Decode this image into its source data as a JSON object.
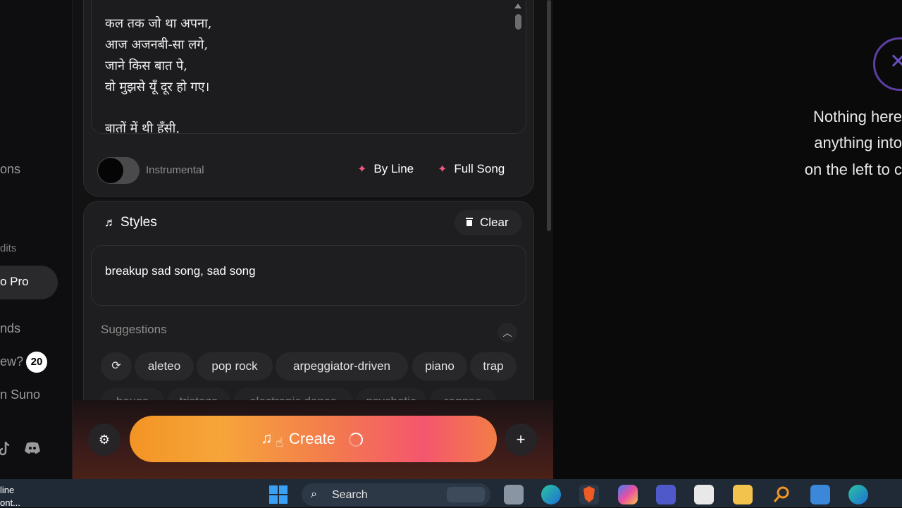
{
  "sidebar": {
    "items": [
      {
        "label": "ons"
      },
      {
        "label": "dits"
      },
      {
        "label": "o Pro"
      },
      {
        "label": "nds"
      },
      {
        "label": "ew?"
      },
      {
        "label": "n Suno"
      }
    ],
    "badge": "20",
    "social_icons": [
      "tiktok-icon",
      "discord-icon"
    ]
  },
  "lyrics": {
    "lines": [
      "कल तक जो था अपना,",
      "आज अजनबी-सा लगे,",
      "जाने किस बात पे,",
      "वो मुझसे यूँ दूर हो गए।",
      "बातों में थी हँसी,"
    ],
    "instrumental_label": "Instrumental",
    "by_line_label": "By Line",
    "full_song_label": "Full Song"
  },
  "styles": {
    "title": "Styles",
    "clear_label": "Clear",
    "value": "breakup sad song, sad song",
    "suggestions_label": "Suggestions",
    "chips": [
      "aleteo",
      "pop rock",
      "arpeggiator-driven",
      "piano",
      "trap"
    ],
    "chips_row2": [
      "house",
      "tristeza",
      "electronic dance",
      "psychotic",
      "reggae"
    ]
  },
  "bottom": {
    "create_label": "Create"
  },
  "right_panel": {
    "lines": [
      "Nothing here",
      "anything into",
      "on the left to c"
    ]
  },
  "taskbar": {
    "left_text_1": "line",
    "left_text_2": "ont...",
    "search_label": "Search"
  },
  "colors": {
    "accent_pink": "#f0587e",
    "create_orange": "#f39424",
    "empty_icon_purple": "#5b3fa3"
  }
}
